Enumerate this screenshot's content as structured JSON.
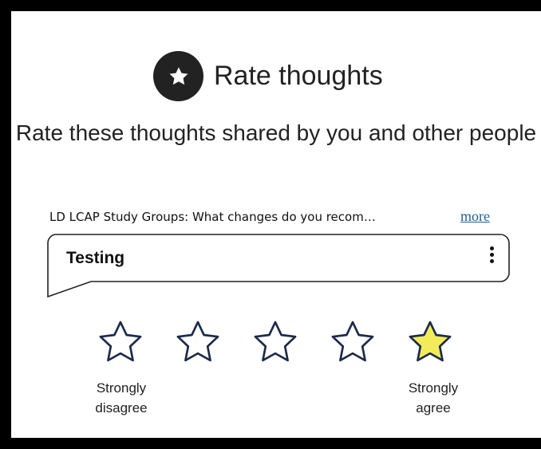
{
  "header": {
    "title": "Rate thoughts",
    "icon": "star-icon"
  },
  "subtitle": "Rate these thoughts shared by you and other people",
  "question": {
    "text": "LD LCAP Study Groups: What changes do you recom…",
    "more_label": "more"
  },
  "thought": {
    "text": "Testing",
    "menu_icon": "kebab-menu-icon"
  },
  "rating": {
    "max": 5,
    "hovered": 5,
    "low_label": "Strongly disagree",
    "high_label": "Strongly agree"
  },
  "colors": {
    "star_outline": "#1c2a4a",
    "star_highlight": "#f2ec5a",
    "link": "#1f5f99",
    "badge": "#222222"
  }
}
